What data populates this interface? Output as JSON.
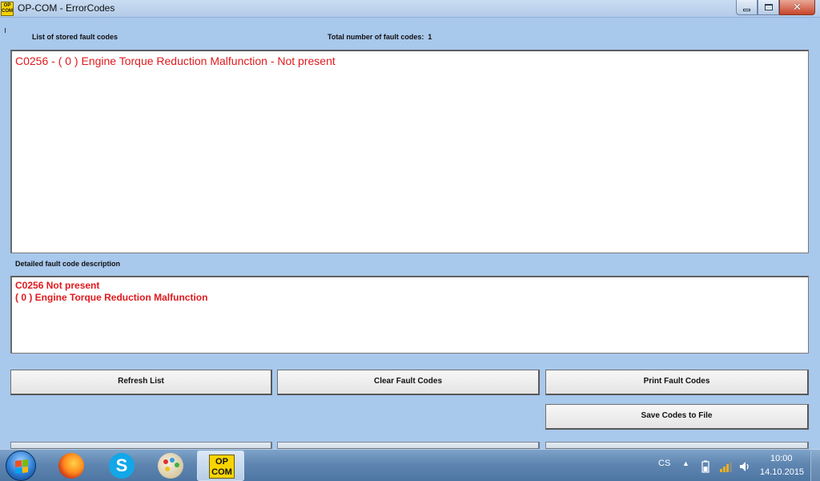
{
  "window": {
    "title": "OP-COM - ErrorCodes",
    "app_icon_line1": "OP",
    "app_icon_line2": "COM"
  },
  "fault_list": {
    "header": "List of stored fault codes",
    "total_label": "Total number of fault codes:",
    "total_count": "1",
    "items": [
      "C0256 - ( 0 )  Engine Torque Reduction Malfunction - Not present"
    ]
  },
  "detail": {
    "header": "Detailed fault code description",
    "lines": [
      "C0256  Not present",
      "( 0 )  Engine Torque Reduction Malfunction"
    ]
  },
  "buttons": {
    "refresh": "Refresh List",
    "clear": "Clear Fault Codes",
    "print": "Print Fault Codes",
    "save": "Save Codes to File"
  },
  "taskbar": {
    "opcom_line1": "OP",
    "opcom_line2": "COM",
    "language": "CS",
    "time": "10:00",
    "date": "14.10.2015"
  },
  "colors": {
    "fault_text": "#e0191d",
    "window_bg": "#a8c8ec"
  },
  "icons": {
    "start": "windows-start-orb",
    "firefox": "firefox-icon",
    "skype": "skype-icon",
    "paint": "paint-palette-icon"
  }
}
